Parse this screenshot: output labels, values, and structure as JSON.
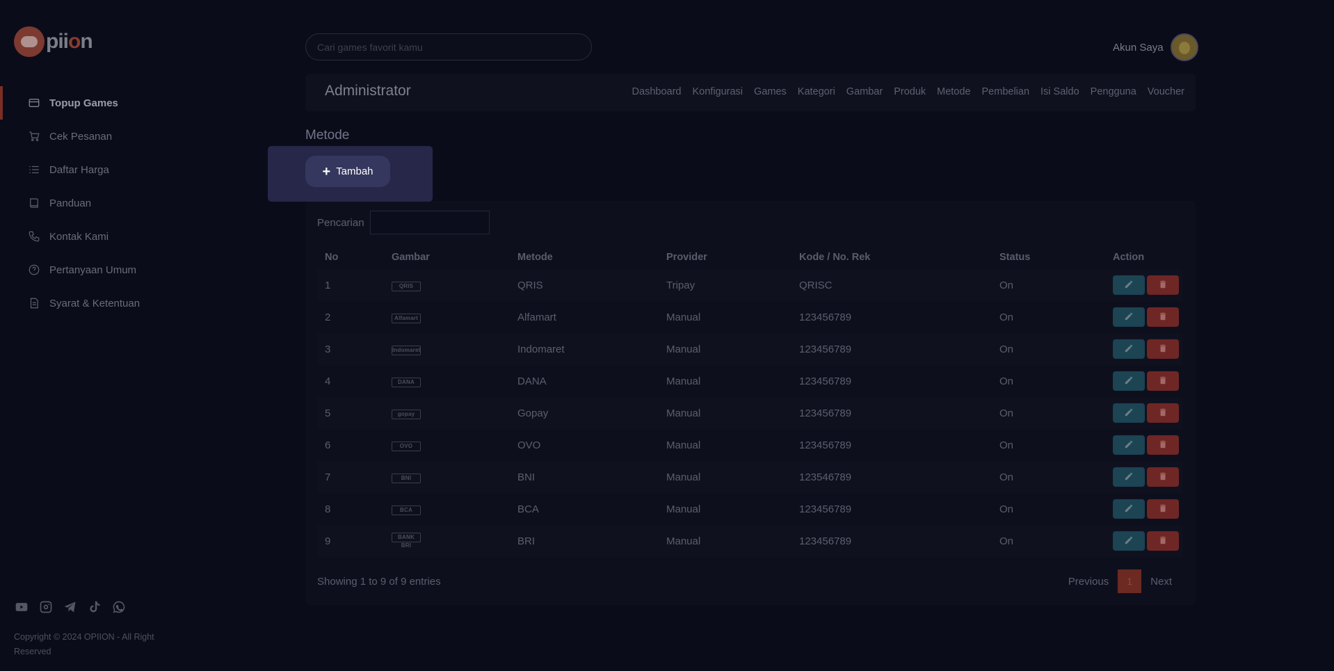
{
  "brand": {
    "logo_text_a": "pii",
    "logo_text_o": "o",
    "logo_text_b": "n"
  },
  "search": {
    "placeholder": "Cari games favorit kamu"
  },
  "account": {
    "label": "Akun Saya"
  },
  "sidebar": {
    "items": [
      {
        "label": "Topup Games",
        "icon": "card-icon",
        "active": true
      },
      {
        "label": "Cek Pesanan",
        "icon": "cart-icon"
      },
      {
        "label": "Daftar Harga",
        "icon": "list-icon"
      },
      {
        "label": "Panduan",
        "icon": "book-icon"
      },
      {
        "label": "Kontak Kami",
        "icon": "phone-icon"
      },
      {
        "label": "Pertanyaan Umum",
        "icon": "question-icon"
      },
      {
        "label": "Syarat & Ketentuan",
        "icon": "document-icon"
      }
    ],
    "socials": [
      "youtube-icon",
      "instagram-icon",
      "telegram-icon",
      "tiktok-icon",
      "whatsapp-icon"
    ],
    "copyright": "Copyright © 2024 OPIION - All Right Reserved"
  },
  "admin": {
    "title": "Administrator",
    "nav": [
      "Dashboard",
      "Konfigurasi",
      "Games",
      "Kategori",
      "Gambar",
      "Produk",
      "Metode",
      "Pembelian",
      "Isi Saldo",
      "Pengguna",
      "Voucher"
    ]
  },
  "page": {
    "title": "Metode",
    "add_button": "Tambah"
  },
  "table": {
    "search_label": "Pencarian",
    "columns": [
      "No",
      "Gambar",
      "Metode",
      "Provider",
      "Kode / No. Rek",
      "Status",
      "Action"
    ],
    "rows": [
      {
        "no": "1",
        "logo": "QRIS",
        "metode": "QRIS",
        "provider": "Tripay",
        "kode": "QRISC",
        "status": "On"
      },
      {
        "no": "2",
        "logo": "Alfamart",
        "metode": "Alfamart",
        "provider": "Manual",
        "kode": "123456789",
        "status": "On"
      },
      {
        "no": "3",
        "logo": "Indomaret",
        "metode": "Indomaret",
        "provider": "Manual",
        "kode": "123456789",
        "status": "On"
      },
      {
        "no": "4",
        "logo": "DANA",
        "metode": "DANA",
        "provider": "Manual",
        "kode": "123456789",
        "status": "On"
      },
      {
        "no": "5",
        "logo": "gopay",
        "metode": "Gopay",
        "provider": "Manual",
        "kode": "123456789",
        "status": "On"
      },
      {
        "no": "6",
        "logo": "OVO",
        "metode": "OVO",
        "provider": "Manual",
        "kode": "123456789",
        "status": "On"
      },
      {
        "no": "7",
        "logo": "BNI",
        "metode": "BNI",
        "provider": "Manual",
        "kode": "123546789",
        "status": "On"
      },
      {
        "no": "8",
        "logo": "BCA",
        "metode": "BCA",
        "provider": "Manual",
        "kode": "123456789",
        "status": "On"
      },
      {
        "no": "9",
        "logo": "BANK BRI",
        "metode": "BRI",
        "provider": "Manual",
        "kode": "123456789",
        "status": "On"
      }
    ],
    "showing": "Showing 1 to 9 of 9 entries",
    "pagination": {
      "previous": "Previous",
      "current": "1",
      "next": "Next"
    }
  },
  "colors": {
    "background": "#0b0c19",
    "accent": "#7a2e26",
    "edit": "#1c4453",
    "delete": "#6e2725",
    "popup": "#262749"
  }
}
